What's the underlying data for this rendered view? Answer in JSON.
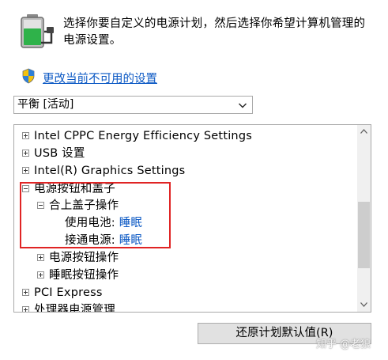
{
  "intro": {
    "line1": "选择你要自定义的电源计划，然后选择你希望计算机管理的",
    "line2": "电源设置。"
  },
  "change_link": "更改当前不可用的设置",
  "plan_select": {
    "value": "平衡 [活动]"
  },
  "tree": {
    "items": [
      {
        "label": "Intel CPPC Energy Efficiency Settings",
        "state": "collapsed"
      },
      {
        "label": "USB 设置",
        "state": "collapsed"
      },
      {
        "label": "Intel(R) Graphics Settings",
        "state": "collapsed"
      },
      {
        "label": "电源按钮和盖子",
        "state": "expanded"
      },
      {
        "label": "合上盖子操作",
        "state": "expanded"
      },
      {
        "label": "使用电池:",
        "value": "睡眠"
      },
      {
        "label": "接通电源:",
        "value": "睡眠"
      },
      {
        "label": "电源按钮操作",
        "state": "collapsed"
      },
      {
        "label": "睡眠按钮操作",
        "state": "collapsed"
      },
      {
        "label": "PCI Express",
        "state": "collapsed"
      },
      {
        "label": "处理器电源管理",
        "state": "collapsed"
      }
    ]
  },
  "restore_button": "还原计划默认值(R)",
  "watermark": "知乎 @老狼",
  "icons": {
    "battery": "battery-plug-icon",
    "shield": "uac-shield-icon",
    "dropdown": "chevron-down-icon",
    "scroll_up": "scroll-up-arrow-icon",
    "scroll_down": "scroll-down-arrow-icon"
  },
  "colors": {
    "link": "#0b58c4",
    "highlight_box": "#e02424"
  }
}
